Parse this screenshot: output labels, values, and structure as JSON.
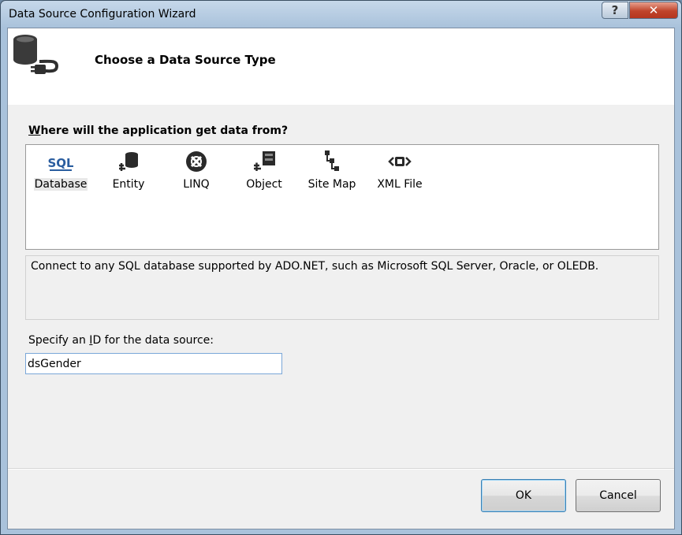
{
  "window": {
    "title": "Data Source Configuration Wizard",
    "help_label": "?",
    "close_label": "✕"
  },
  "header": {
    "title": "Choose a Data Source Type"
  },
  "source": {
    "question_prefix": "W",
    "question_rest": "here will the application get data from?",
    "types": [
      {
        "label": "Database",
        "icon": "sql-database-icon",
        "selected": true
      },
      {
        "label": "Entity",
        "icon": "entity-icon",
        "selected": false
      },
      {
        "label": "LINQ",
        "icon": "linq-icon",
        "selected": false
      },
      {
        "label": "Object",
        "icon": "object-icon",
        "selected": false
      },
      {
        "label": "Site Map",
        "icon": "site-map-icon",
        "selected": false
      },
      {
        "label": "XML File",
        "icon": "xml-file-icon",
        "selected": false
      }
    ],
    "sql_icon_text": "SQL",
    "description": "Connect to any SQL database supported by ADO.NET, such as Microsoft SQL Server, Oracle, or OLEDB."
  },
  "id_field": {
    "label_before": "Specify an ",
    "label_accel": "I",
    "label_after": "D for the data source:",
    "value": "dsGender"
  },
  "buttons": {
    "ok": "OK",
    "cancel": "Cancel"
  },
  "colors": {
    "title_bar": "#a9c2db",
    "close_button": "#c0442b",
    "selection_bg": "#e8e8e8",
    "default_button_border": "#3c7fb1"
  }
}
